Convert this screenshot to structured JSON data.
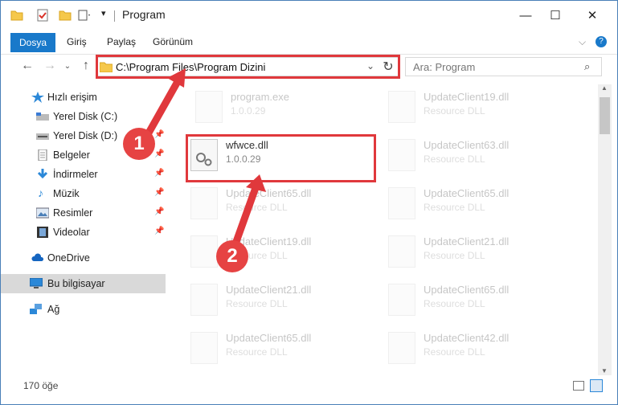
{
  "window": {
    "title": "Program"
  },
  "ribbon": {
    "tabs": [
      "Dosya",
      "Giriş",
      "Paylaş",
      "Görünüm"
    ]
  },
  "address": {
    "path": "C:\\Program Files\\Program Dizini"
  },
  "search": {
    "placeholder": "Ara: Program"
  },
  "nav": {
    "items": [
      {
        "label": "Hızlı erişim",
        "icon": "star-icon"
      },
      {
        "label": "Yerel Disk (C:)",
        "icon": "drive-icon",
        "pinned": true
      },
      {
        "label": "Yerel Disk (D:)",
        "icon": "drive-icon",
        "pinned": true
      },
      {
        "label": "Belgeler",
        "icon": "documents-icon",
        "pinned": true
      },
      {
        "label": "İndirmeler",
        "icon": "download-icon",
        "pinned": true
      },
      {
        "label": "Müzik",
        "icon": "music-icon",
        "pinned": true
      },
      {
        "label": "Resimler",
        "icon": "pictures-icon",
        "pinned": true
      },
      {
        "label": "Videolar",
        "icon": "video-icon",
        "pinned": true
      },
      {
        "label": "OneDrive",
        "icon": "cloud-icon"
      },
      {
        "label": "Bu bilgisayar",
        "icon": "computer-icon",
        "selected": true
      },
      {
        "label": "Ağ",
        "icon": "network-icon"
      }
    ]
  },
  "files": [
    {
      "name": "program.exe",
      "sub": "1.0.0.29"
    },
    {
      "name": "UpdateClient19.dll",
      "sub": "Resource DLL"
    },
    {
      "name": "wfwce.dll",
      "sub": "1.0.0.29"
    },
    {
      "name": "UpdateClient63.dll",
      "sub": "Resource DLL"
    },
    {
      "name": "UpdateClient65.dll",
      "sub": "Resource DLL"
    },
    {
      "name": "UpdateClient65.dll",
      "sub": "Resource DLL"
    },
    {
      "name": "UpdateClient19.dll",
      "sub": "Resource DLL"
    },
    {
      "name": "UpdateClient21.dll",
      "sub": "Resource DLL"
    },
    {
      "name": "UpdateClient21.dll",
      "sub": "Resource DLL"
    },
    {
      "name": "UpdateClient65.dll",
      "sub": "Resource DLL"
    },
    {
      "name": "UpdateClient65.dll",
      "sub": "Resource DLL"
    },
    {
      "name": "UpdateClient42.dll",
      "sub": "Resource DLL"
    }
  ],
  "status": {
    "count": "170 öğe"
  },
  "annotations": {
    "step1": "1",
    "step2": "2"
  },
  "colors": {
    "accent": "#1979ca",
    "highlight": "#e0383c"
  }
}
